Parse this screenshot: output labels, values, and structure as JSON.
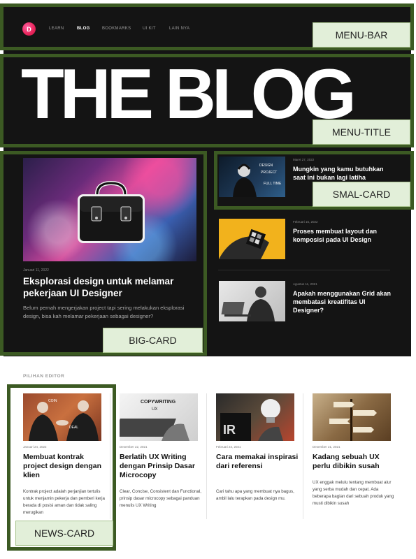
{
  "logo_letter": "D",
  "nav": [
    "LEARN",
    "BLOG",
    "BOOKMARKS",
    "UI KIT",
    "LAIN NYA"
  ],
  "active_nav": "BLOG",
  "title": "THE BLOG",
  "big_card": {
    "date": "Januari 11, 2022",
    "title": "Eksplorasi design untuk melamar pekerjaan UI Designer",
    "desc": "Belum pernah mengerjakan project tapi sering melakukan eksplorasi design, bisa kah melamar pekerjaan sebagai designer?"
  },
  "small_cards": [
    {
      "date": "Maret 27, 2022",
      "title": "Mungkin yang kamu butuhkan saat ini bukan lagi latiha"
    },
    {
      "date": "Februari 15, 2022",
      "title": "Proses membuat layout dan komposisi pada UI Design"
    },
    {
      "date": "Agustus 11, 2021",
      "title": "Apakah menggunakan Grid akan membatasi kreatifitas UI Designer?"
    }
  ],
  "picks_label": "PILIHAN EDITOR",
  "news_cards": [
    {
      "date": "Januari 24, 2022",
      "title": "Membuat kontrak project design dengan klien",
      "desc": "Kontrak project adalah perjanjian tertulis untuk menjamin pekerja dan pemberi kerja berada di posisi aman dan tidak saling merugikan"
    },
    {
      "date": "Desember 22, 2021",
      "title": "Berlatih UX Writing dengan Prinsip Dasar Microcopy",
      "desc": "Clear, Concise, Consistent dan Functional, prinsip dasar microcopy sebagai panduan menulis UX Writing"
    },
    {
      "date": "Februari 24, 2021",
      "title": "Cara memakai inspirasi dari referensi",
      "desc": "Cari tahu apa yang membuat nya bagus, ambil lalu terapkan pada design mu."
    },
    {
      "date": "Desember 21, 2021",
      "title": "Kadang sebuah UX perlu dibikin susah",
      "desc": "UX enggak melulu tentang membuat alur yang serba mudah dan cepat. Ada beberapa bagian dari sebuah produk yang musti dibikin susah"
    }
  ],
  "annotations": {
    "menu_bar": "MENU-BAR",
    "menu_title": "MENU-TITLE",
    "small_card": "SMAL-CARD",
    "big_card": "BIG-CARD",
    "news_card": "NEWS-CARD"
  },
  "colors": {
    "dark_bg": "#141414",
    "annotation_border": "#3c5a23",
    "annotation_tag_bg": "#e2efd9",
    "logo_accent": "#e8245a"
  }
}
